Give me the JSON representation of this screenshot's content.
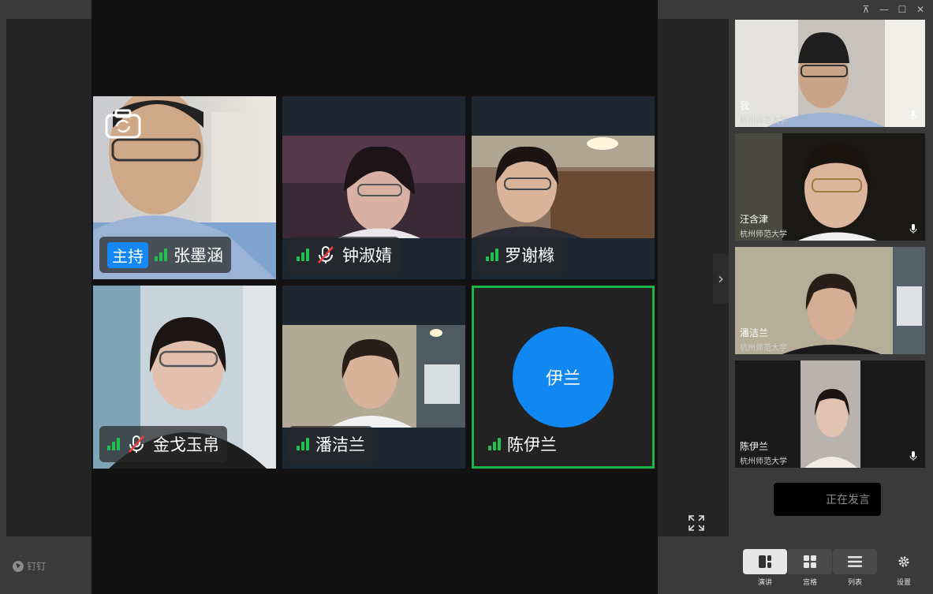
{
  "window": {
    "controls": [
      "⊼",
      "—",
      "☐",
      "✕"
    ]
  },
  "brand": {
    "label": "钉钉"
  },
  "grid": {
    "tiles": [
      {
        "name": "张墨涵",
        "host_badge": "主持",
        "muted": false
      },
      {
        "name": "钟淑婧",
        "muted": true
      },
      {
        "name": "罗谢橼",
        "muted": false
      },
      {
        "name": "金戈玉帛",
        "muted": true
      },
      {
        "name": "潘洁兰",
        "muted": false
      },
      {
        "name": "陈伊兰",
        "muted": false,
        "avatar_text": "伊兰",
        "selected": true
      }
    ]
  },
  "sidebar": {
    "thumbs": [
      {
        "name": "我",
        "org": "杭州师范大学"
      },
      {
        "name": "汪含津",
        "org": "杭州师范大学"
      },
      {
        "name": "潘洁兰",
        "org": "杭州师范大学"
      },
      {
        "name": "陈伊兰",
        "org": "杭州师范大学"
      }
    ],
    "speaking_label": "正在发言"
  },
  "toolbar": {
    "buttons": [
      {
        "label": "演讲",
        "icon": "speaker-layout-icon",
        "active": true
      },
      {
        "label": "宫格",
        "icon": "grid-layout-icon",
        "active": false
      },
      {
        "label": "列表",
        "icon": "list-layout-icon",
        "active": false
      },
      {
        "label": "设置",
        "icon": "gear-icon",
        "active": false
      }
    ]
  },
  "colors": {
    "host_badge": "#1487f5",
    "signal": "#1fc24f",
    "selected_border": "#1db44a",
    "avatar": "#1187f2"
  }
}
